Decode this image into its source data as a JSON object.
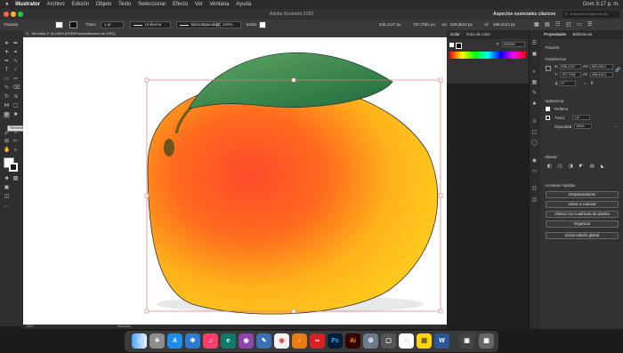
{
  "menubar": {
    "apple": "",
    "items": [
      "Illustrator",
      "Archivo",
      "Edición",
      "Objeto",
      "Texto",
      "Seleccionar",
      "Efecto",
      "Ver",
      "Ventana",
      "Ayuda"
    ],
    "clock": "Dom 3:17 p. m."
  },
  "titlebar": {
    "title": "Adobe Illustrator 2020",
    "workspace": "Aspectos esenciales clásicos",
    "search_placeholder": "Buscar en Adobe Stock"
  },
  "controlbar": {
    "label_trazado": "Trazado",
    "label_trazo": "Trazo:",
    "stroke_value": "1 pt",
    "profile": "Uniforme",
    "brush": "Básico",
    "label_opacidad": "Opacidad:",
    "opacity_value": "100%",
    "label_estilo": "Estilo:",
    "x_value": "636,1137 px",
    "y_value": "767,7931 px",
    "w_label": "An:",
    "w_value": "629,3614 px",
    "h_label": "Al:",
    "h_value": "498,4413 px"
  },
  "document": {
    "tab": "Sin título-1* al 100% (RGB/Previsualización de GPU)",
    "zoom": "100%",
    "status": "Selección"
  },
  "tooltip": "Herramienta Malla (U)",
  "colorpanel": {
    "tab1": "Color",
    "tab2": "Guía de color",
    "hex_symbol": "#",
    "hex": "000000"
  },
  "props": {
    "tab1": "Propiedades",
    "tab2": "Bibliotecas",
    "object_type": "Trazado",
    "transform_title": "Transformar",
    "x_label": "X:",
    "x_val": "636,1137",
    "y_label": "Y:",
    "y_val": "767,7931",
    "w_label": "An:",
    "w_val": "629,3614",
    "h_label": "Al:",
    "h_val": "498,4413",
    "angle_val": "0°",
    "appearance_title": "Apariencia",
    "fill_label": "Relleno",
    "stroke_label": "Trazo",
    "stroke_val": "1 pt",
    "opacity_label": "Opacidad",
    "opacity_val": "100%",
    "align_title": "Alinear",
    "quick_actions_title": "Acciones rápidas",
    "btn1": "Desplazamiento",
    "btn2": "Volver a colorear",
    "btn3": "Alinear con cuadrícula de píxeles",
    "btn4": "Organizar",
    "btn5": "Iniciar edición global"
  },
  "dock": {
    "apps": [
      "Finder",
      "Launchpad",
      "App Store",
      "Safari",
      "Música",
      "Edge",
      "Podcasts",
      "Vista previa",
      "Chrome",
      "Blender",
      "Creative Cloud",
      "Photoshop",
      "Illustrator",
      "Preferencias",
      "Spotlight",
      "Webex",
      "Notas",
      "Word",
      "Captura",
      "Papelera"
    ],
    "ps": "Ps",
    "ai": "Ai",
    "w": "W"
  },
  "colors": {
    "accent_blue": "#1f6feb",
    "ai_orange": "#ff9a00",
    "selection_red": "#e0787a"
  }
}
